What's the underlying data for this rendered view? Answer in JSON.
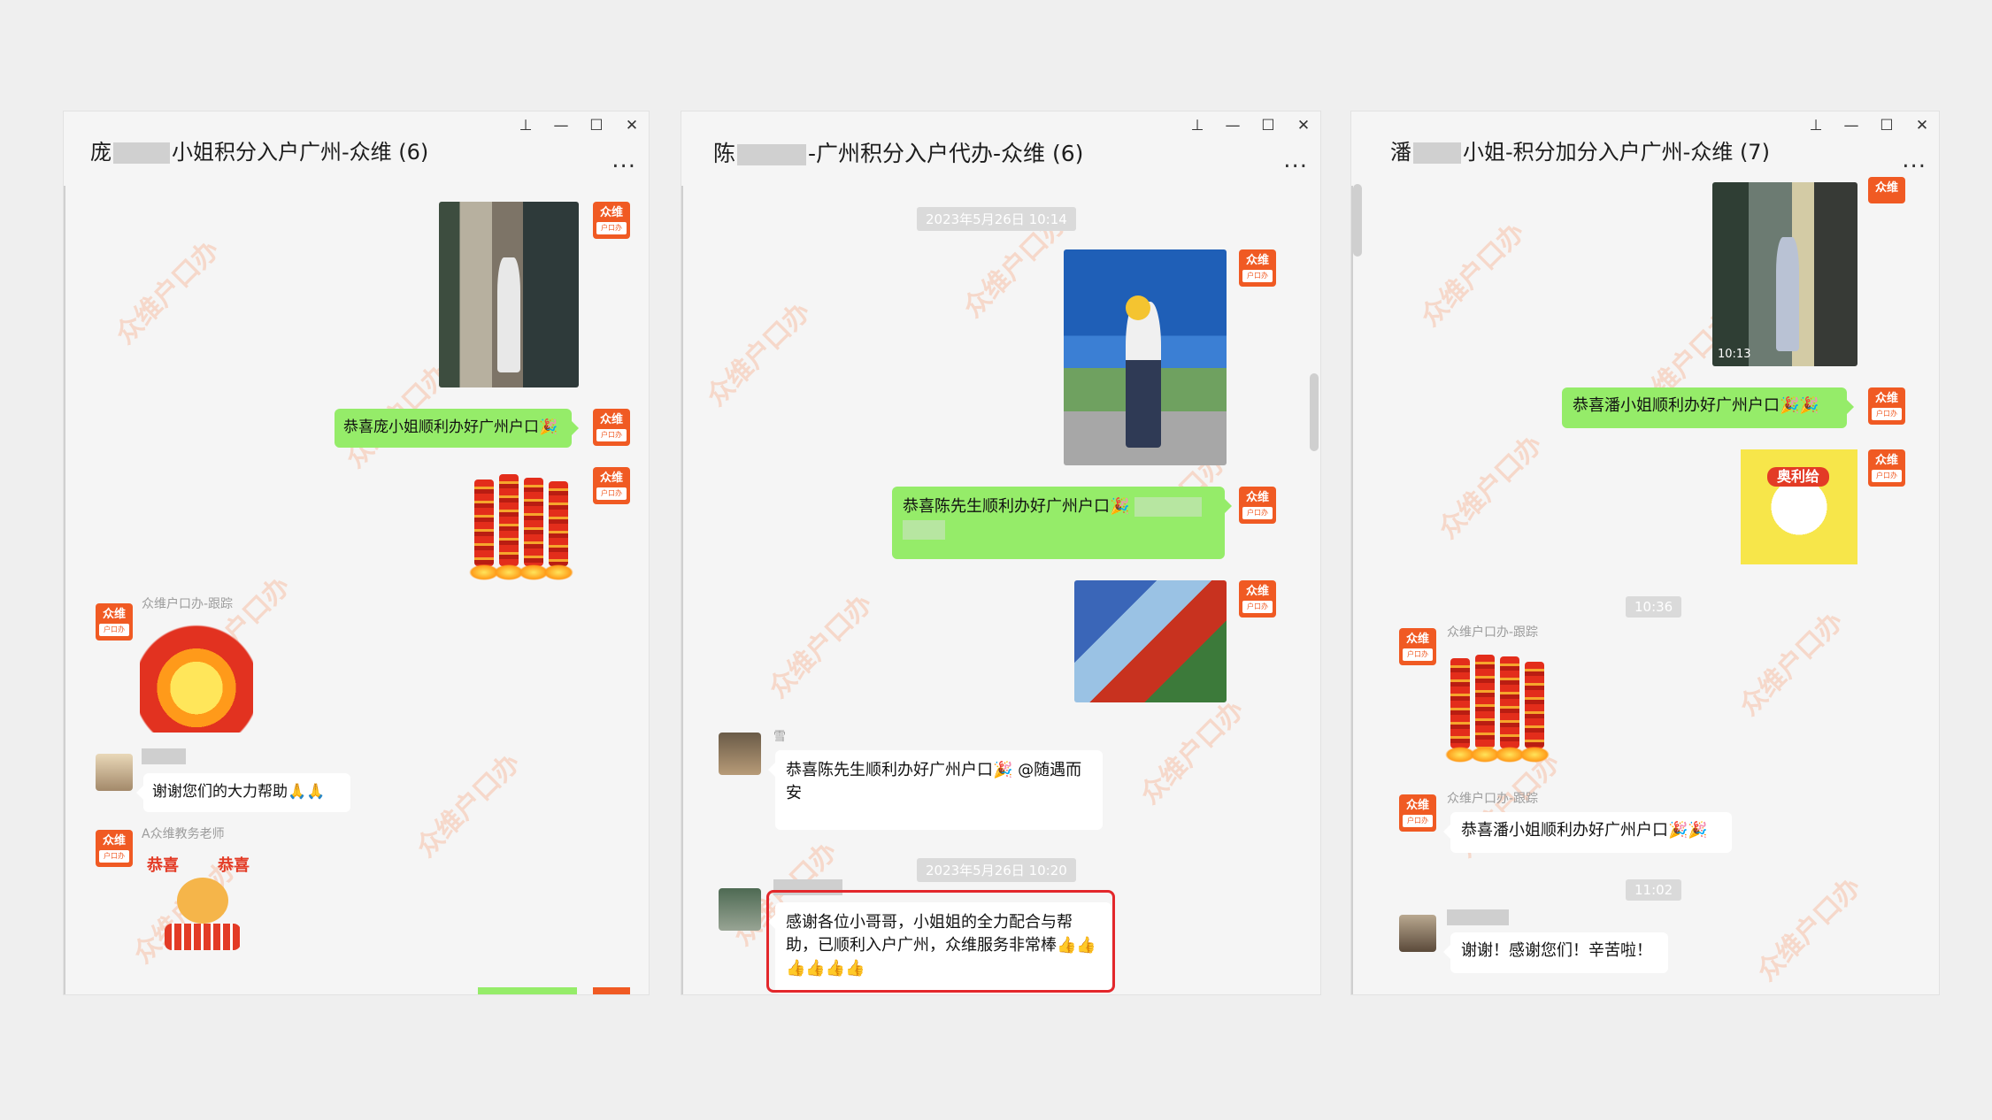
{
  "windows": [
    {
      "id": "w1",
      "title_prefix": "庞",
      "title_suffix": "小姐积分入户广州-众维 (6)",
      "controls": {
        "pin": "⊥",
        "minimize": "—",
        "maximize": "☐",
        "close": "✕"
      },
      "more": "...",
      "messages": {
        "m1_text": "恭喜庞小姐顺利办好广州户口🎉",
        "sender1": "众维户口办-跟踪",
        "m2_text": "谢谢您们的大力帮助🙏🙏",
        "sender3": "A众维教务老师",
        "sticker_text_left": "恭喜",
        "sticker_text_right": "恭喜"
      }
    },
    {
      "id": "w2",
      "title_prefix": "陈",
      "title_suffix": "-广州积分入户代办-众维 (6)",
      "controls": {
        "pin": "⊥",
        "minimize": "—",
        "maximize": "☐",
        "close": "✕"
      },
      "more": "...",
      "messages": {
        "time1": "2023年5月26日 10:14",
        "m1_text": "恭喜陈先生顺利办好广州户口🎉",
        "sender1": "雪",
        "m2_text": "恭喜陈先生顺利办好广州户口🎉 @随遇而安",
        "time2": "2023年5月26日 10:20",
        "m3_text": "感谢各位小哥哥，小姐姐的全力配合与帮助，已顺利入户广州，众维服务非常棒",
        "m3_emoji": "👍👍👍👍👍👍"
      }
    },
    {
      "id": "w3",
      "title_prefix": "潘",
      "title_suffix": "小姐-积分加分入户广州-众维 (7)",
      "controls": {
        "pin": "⊥",
        "minimize": "—",
        "maximize": "☐",
        "close": "✕"
      },
      "more": "...",
      "messages": {
        "photo_time": "10:13",
        "m1_text": "恭喜潘小姐顺利办好广州户口🎉🎉",
        "sticker_text": "奥利给",
        "time1": "10:36",
        "sender1": "众维户口办-跟踪",
        "sender2": "众维户口办-跟踪",
        "m2_text": "恭喜潘小姐顺利办好广州户口🎉🎉",
        "time2": "11:02",
        "m3_text": "谢谢！感谢您们！辛苦啦！"
      }
    }
  ],
  "brand": {
    "logo": "众维",
    "slogan": "户口办",
    "color": "#f05a23"
  },
  "watermark": "众维户口办"
}
